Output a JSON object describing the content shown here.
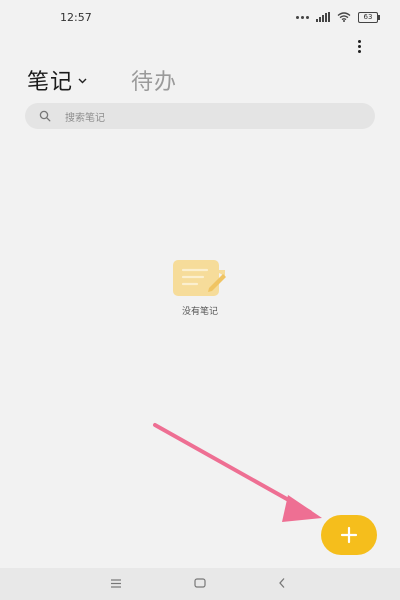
{
  "status_bar": {
    "time": "12:57",
    "battery": "63"
  },
  "tabs": {
    "notes_label": "笔记",
    "todo_label": "待办"
  },
  "search": {
    "placeholder": "搜索笔记"
  },
  "empty_state": {
    "text": "没有笔记"
  },
  "colors": {
    "background": "#f2f2f2",
    "accent": "#f5be1c",
    "annotation_arrow": "#ee6f93"
  },
  "icons": {
    "more": "more-vertical-icon",
    "chevron": "chevron-down-icon",
    "search": "search-icon",
    "empty": "note-edit-icon",
    "fab": "plus-icon",
    "nav_menu": "menu-icon",
    "nav_home": "home-icon",
    "nav_back": "back-icon"
  }
}
